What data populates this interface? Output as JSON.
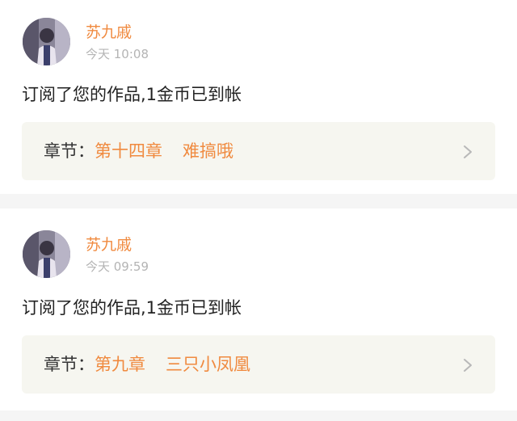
{
  "notifications": [
    {
      "username": "苏九戚",
      "time": "今天 10:08",
      "message": "订阅了您的作品,1金币已到帐",
      "chapter": {
        "key": "章节",
        "colon": "：",
        "number": "第十四章",
        "title": "难搞哦"
      }
    },
    {
      "username": "苏九戚",
      "time": "今天 09:59",
      "message": "订阅了您的作品,1金币已到帐",
      "chapter": {
        "key": "章节",
        "colon": "：",
        "number": "第九章",
        "title": "三只小凤凰"
      }
    }
  ],
  "colors": {
    "accent": "#f08a3f",
    "background": "#f5f5f5",
    "card": "#ffffff",
    "chapter_box": "#f6f6f0",
    "time": "#b4b4b4"
  },
  "icons": {
    "avatar": "user-avatar-photo",
    "chevron": "chevron-right-icon"
  }
}
